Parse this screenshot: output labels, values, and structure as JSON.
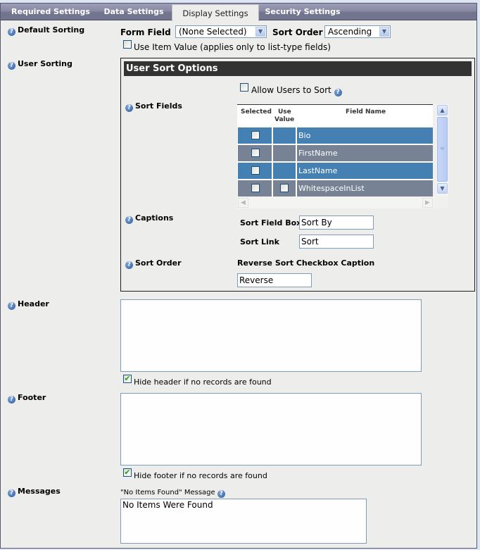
{
  "tabs": [
    {
      "label": "Required Settings",
      "active": false
    },
    {
      "label": "Data Settings",
      "active": false
    },
    {
      "label": "Display Settings",
      "active": true
    },
    {
      "label": "Security Settings",
      "active": false
    }
  ],
  "default_sorting": {
    "label": "Default Sorting",
    "form_field_label": "Form Field",
    "form_field_value": "(None Selected)",
    "sort_order_label": "Sort Order",
    "sort_order_value": "Ascending",
    "use_item_value_label": "Use Item Value (applies only to list-type fields)",
    "use_item_value_checked": false
  },
  "user_sorting": {
    "label": "User Sorting",
    "box_title": "User Sort Options",
    "allow_users_label": "Allow Users to Sort",
    "allow_users_checked": false,
    "sort_fields_label": "Sort Fields",
    "grid": {
      "headers": {
        "selected": "Selected",
        "use": "Use",
        "value": "Value",
        "field_name": "Field Name"
      },
      "rows": [
        {
          "field_name": "Bio",
          "selected": false,
          "use_value_available": false,
          "use_value": false
        },
        {
          "field_name": "FirstName",
          "selected": false,
          "use_value_available": false,
          "use_value": false
        },
        {
          "field_name": "LastName",
          "selected": false,
          "use_value_available": false,
          "use_value": false
        },
        {
          "field_name": "WhitespaceInList",
          "selected": false,
          "use_value_available": true,
          "use_value": false
        }
      ]
    },
    "captions_label": "Captions",
    "sort_field_box_label": "Sort Field Box",
    "sort_field_box_value": "Sort By",
    "sort_link_label": "Sort Link",
    "sort_link_value": "Sort",
    "sort_order_label": "Sort Order",
    "reverse_caption_label": "Reverse Sort Checkbox Caption",
    "reverse_caption_value": "Reverse"
  },
  "header": {
    "label": "Header",
    "value": "",
    "hide_label": "Hide header if no records are found",
    "hide_checked": true
  },
  "footer": {
    "label": "Footer",
    "value": "",
    "hide_label": "Hide footer if no records are found",
    "hide_checked": true
  },
  "messages": {
    "label": "Messages",
    "no_items_label": "\"No Items Found\" Message",
    "no_items_value": "No Items Were Found"
  },
  "icons": {
    "help": "?",
    "check": "✔",
    "arrow_down": "▼",
    "arrow_up": "▲",
    "arrow_left": "◀",
    "arrow_right": "▶",
    "grip": "≡"
  }
}
